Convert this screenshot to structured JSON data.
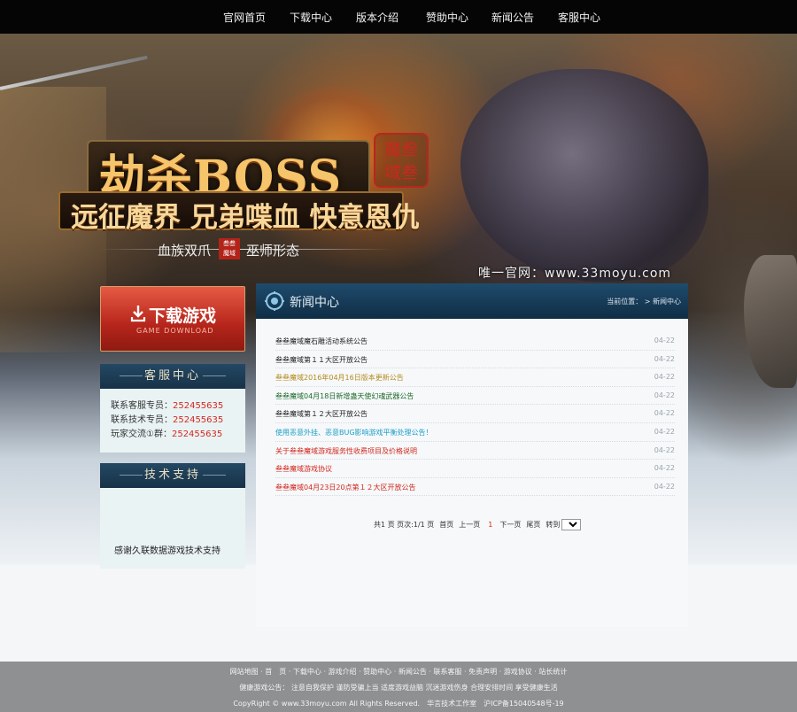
{
  "nav": {
    "items": [
      "官网首页",
      "下载中心",
      "版本介绍",
      "赞助中心",
      "新闻公告",
      "客服中心"
    ]
  },
  "banner": {
    "title": "劫杀BOSS",
    "seal": [
      "魔叁",
      "域叁"
    ],
    "subtitle": "远征魔界 兄弟喋血 快意恩仇",
    "tag_left": "血族双爪",
    "tag_right": "巫师形态",
    "watermark": "唯一官网：www.33moyu.com"
  },
  "download": {
    "label": "下载游戏",
    "sub": "GAME DOWNLOAD"
  },
  "service": {
    "title": "客服中心",
    "lines": [
      {
        "label": "联系客服专员：",
        "value": "252455635"
      },
      {
        "label": "联系技术专员：",
        "value": "252455635"
      },
      {
        "label": "玩家交流①群：",
        "value": "252455635"
      }
    ]
  },
  "support": {
    "title": "技术支持",
    "text": "感谢久联数据游戏技术支持"
  },
  "news": {
    "title": "新闻中心",
    "breadcrumb": "当前位置： > 新闻中心",
    "items": [
      {
        "title": "叁叁魔域魔石雕活动系统公告",
        "date": "04-22",
        "color": "#222222"
      },
      {
        "title": "叁叁魔域第１１大区开放公告",
        "date": "04-22",
        "color": "#222222"
      },
      {
        "title": "叁叁魔域2016年04月16日版本更新公告",
        "date": "04-22",
        "color": "#b58a1c"
      },
      {
        "title": "叁叁魔域04月18日新增蛊天使幻魂武器公告",
        "date": "04-22",
        "color": "#1d6b2a"
      },
      {
        "title": "叁叁魔域第１２大区开放公告",
        "date": "04-22",
        "color": "#222222"
      },
      {
        "title": "使用恶意外挂、恶意BUG影响游戏平衡处理公告！",
        "date": "04-22",
        "color": "#1a9ec8"
      },
      {
        "title": "关于叁叁魔域游戏服务性收费项目及价格说明",
        "date": "04-22",
        "color": "#d2281e"
      },
      {
        "title": "叁叁魔域游戏协议",
        "date": "04-22",
        "color": "#d2281e"
      },
      {
        "title": "叁叁魔域04月23日20点第１２大区开放公告",
        "date": "04-22",
        "color": "#d2281e"
      }
    ],
    "pager": {
      "summary": "共1 页 页次:1/1 页",
      "first": "首页",
      "prev": "上一页",
      "current": "1",
      "next": "下一页",
      "last": "尾页",
      "goto": "转到",
      "selected": "1"
    }
  },
  "footer": {
    "line1": "网站地图 · 首　页 · 下载中心 · 游戏介绍 · 赞助中心 · 新闻公告 · 联系客服 · 免责声明 · 游戏协议 · 站长统计",
    "line2": "健康游戏公告：  注意自我保护 谨防受骗上当 适度游戏益脑 沉迷游戏伤身 合理安排时间 享受健康生活",
    "line3": "CopyRight © www.33moyu.com All Rights Reserved.　华言技术工作室　沪ICP备15040548号-19"
  },
  "colors": {
    "accent_red": "#d2281e",
    "nav_bg": "#050505",
    "panel_header": "#1f4b6c",
    "footer_bg": "#8f9092"
  }
}
